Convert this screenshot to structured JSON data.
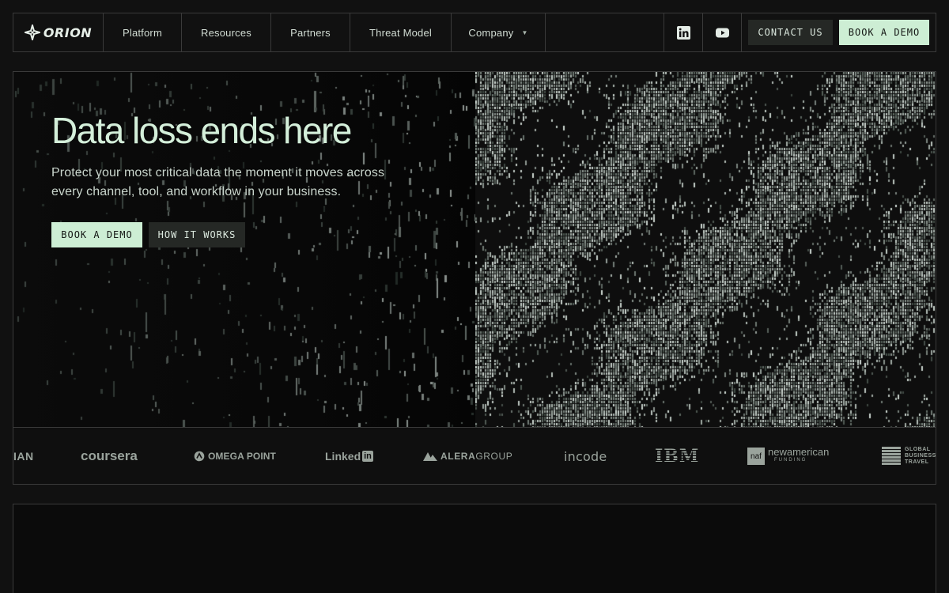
{
  "nav": {
    "brand": "ORION",
    "items": [
      {
        "label": "Platform"
      },
      {
        "label": "Resources"
      },
      {
        "label": "Partners"
      },
      {
        "label": "Threat Model"
      },
      {
        "label": "Company"
      }
    ],
    "contact_label": "CONTACT US",
    "demo_label": "BOOK A DEMO"
  },
  "hero": {
    "title": "Data loss ends here",
    "subtitle": "Protect your most critical data the moment it moves across every channel, tool, and workflow in your business.",
    "primary_cta": "BOOK A DEMO",
    "secondary_cta": "HOW IT WORKS"
  },
  "logos": {
    "partial_left": "IAN",
    "coursera": "coursera",
    "omega": "OMEGA POINT",
    "linkedin": "Linked",
    "linkedin_in": "in",
    "alera_a": "ALERA",
    "alera_b": "GROUP",
    "incode": "incode",
    "ibm": "IBM",
    "naf_mark": "naf",
    "naf_name": "newamerican",
    "naf_sub": "FUNDING",
    "gbt_1": "GLOBAL",
    "gbt_2": "BUSINESS",
    "gbt_3": "TRAVEL"
  },
  "colors": {
    "background": "#111111",
    "accent": "#cdeed4",
    "border": "#3a3a3a",
    "text": "#d4efda"
  }
}
